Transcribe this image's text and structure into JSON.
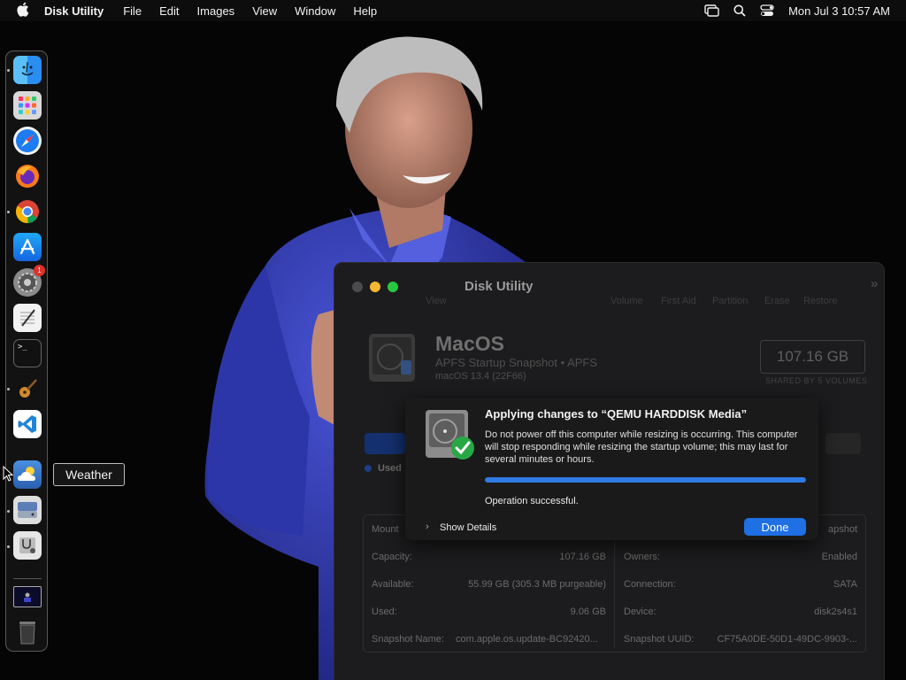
{
  "menubar": {
    "app_name": "Disk Utility",
    "menus": [
      "File",
      "Edit",
      "Images",
      "View",
      "Window",
      "Help"
    ],
    "clock": "Mon Jul 3  10:57 AM",
    "icons": [
      "apple-icon",
      "screen-mirroring-icon",
      "spotlight-search-icon",
      "control-center-icon"
    ]
  },
  "dock": {
    "items": [
      "Finder",
      "Launchpad",
      "Safari",
      "Firefox",
      "Chrome",
      "App Store",
      "System Settings",
      "TextEdit",
      "Terminal",
      "GarageBand",
      "Visual Studio Code",
      "Weather",
      "Disk Utility",
      "Disk Utility Helper",
      "Screenshot",
      "Trash"
    ],
    "settings_badge": "1",
    "tooltip": "Weather"
  },
  "window": {
    "title": "Disk Utility",
    "toolbar": {
      "view": "View",
      "volume": "Volume",
      "first_aid": "First Aid",
      "partition": "Partition",
      "erase": "Erase",
      "restore": "Restore"
    },
    "volume": {
      "name": "MacOS",
      "subtitle": "APFS Startup Snapshot • APFS",
      "os": "macOS 13.4 (22F66)",
      "capacity": "107.16 GB",
      "shared": "SHARED BY 5 VOLUMES"
    },
    "usage": {
      "used_label": "Used",
      "used_fraction": 0.085
    },
    "info": {
      "mount_label": "Mount",
      "type_value": "apshot",
      "capacity_label": "Capacity:",
      "capacity_value": "107.16 GB",
      "available_label": "Available:",
      "available_value": "55.99 GB (305.3 MB purgeable)",
      "used_label": "Used:",
      "used_value": "9.06 GB",
      "snapshot_label": "Snapshot Name:",
      "snapshot_value": "com.apple.os.update-BC92420...",
      "owners_label": "Owners:",
      "owners_value": "Enabled",
      "connection_label": "Connection:",
      "connection_value": "SATA",
      "device_label": "Device:",
      "device_value": "disk2s4s1",
      "uuid_label": "Snapshot UUID:",
      "uuid_value": "CF75A0DE-50D1-49DC-9903-..."
    }
  },
  "sheet": {
    "title": "Applying changes to “QEMU HARDDISK Media”",
    "message": "Do not power off this computer while resizing is occurring. This computer will stop responding while resizing the startup volume; this may last for several minutes or hours.",
    "progress": 1.0,
    "status": "Operation successful.",
    "show_details": "Show Details",
    "done": "Done"
  },
  "colors": {
    "accent": "#1f6fe5",
    "progress": "#2f7ae5",
    "close": "#4b4b4b",
    "minimize": "#f5b631",
    "maximize": "#27c840",
    "shirt": "#3c45c4"
  }
}
